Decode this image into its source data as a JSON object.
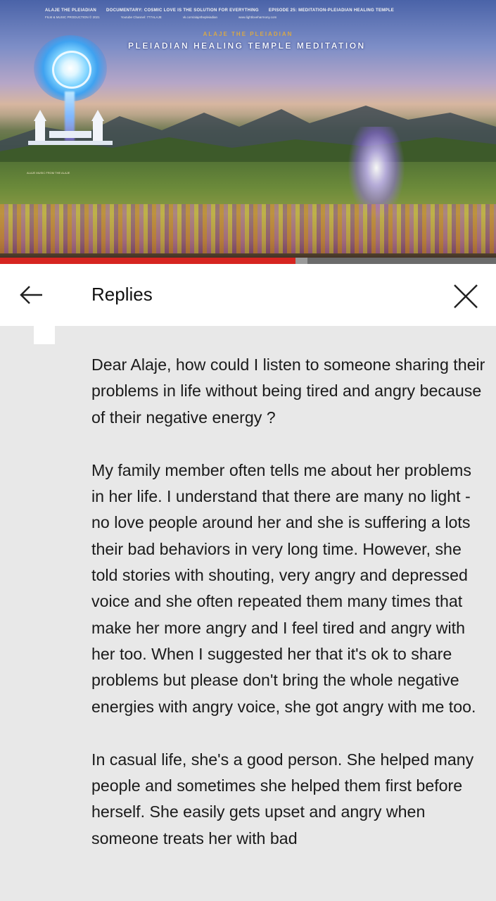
{
  "video": {
    "channel_line": "ALAJE THE PLEIADIAN",
    "documentary_line": "DOCUMENTARY: COSMIC LOVE IS THE SOLUTION FOR EVERYTHING",
    "episode_line": "EPISODE 25: MEDITATION-PLEIADIAN HEALING TEMPLE",
    "credit_line": "FILM & MUSIC PRODUCTION © 2021",
    "youtube_line": "Youtube Channel: 777ALAJE",
    "vk_line": "vk.com/alajethepleiadian",
    "web_line": "www.lightloveharmony.com",
    "brand_small": "ALAJE THE PLEIADIAN",
    "brand_title": "PLEIADIAN HEALING TEMPLE MEDITATION",
    "caption": "ALAJE MUSIC FROM THE ALAJE",
    "progress_fraction": 0.596
  },
  "header": {
    "title": "Replies"
  },
  "comment": {
    "paragraphs": [
      "Dear Alaje, how could I listen to someone sharing their problems in life without being tired and angry because of their negative energy ?",
      "My family member often tells me about her problems in her life. I understand that there are many no light - no love people around her and she is suffering a lots their bad behaviors in very long time. However,  she told stories with shouting, very angry and depressed voice and she often repeated them many times that make her more angry and I feel tired and angry with her too. When I suggested her that it's ok to share problems but please don't bring the whole negative energies with angry voice, she got angry with me too.",
      "In casual life, she's a good person. She helped many people and sometimes she helped them first before herself. She easily gets upset and angry when someone treats her with bad"
    ]
  },
  "colors": {
    "progress": "#d62520",
    "background": "#e8e8e8",
    "header_bg": "#ffffff"
  }
}
